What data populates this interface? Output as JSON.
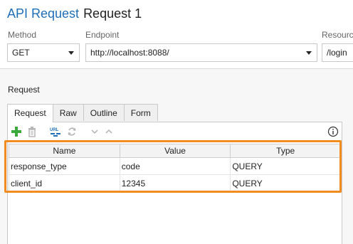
{
  "header": {
    "app": "API Request",
    "name": "Request 1"
  },
  "fields": {
    "method_label": "Method",
    "method_value": "GET",
    "endpoint_label": "Endpoint",
    "endpoint_value": "http://localhost:8088/",
    "resource_label": "Resource",
    "resource_value": "/login"
  },
  "section": {
    "label": "Request"
  },
  "tabs": [
    "Request",
    "Raw",
    "Outline",
    "Form"
  ],
  "toolbar": {
    "add_icon": "plus-icon",
    "delete_icon": "trash-icon",
    "url_icon": "url-encode-icon",
    "refresh_icon": "refresh-icon",
    "down_icon": "chevron-down-icon",
    "up_icon": "chevron-up-icon",
    "info_icon": "info-icon",
    "url_text": "URL"
  },
  "table": {
    "columns": [
      "Name",
      "Value",
      "Type"
    ],
    "rows": [
      {
        "name": "response_type",
        "value": "code",
        "type": "QUERY"
      },
      {
        "name": "client_id",
        "value": "12345",
        "type": "QUERY"
      }
    ]
  },
  "colors": {
    "accent": "#1f6fb8",
    "highlight": "#f28c1e",
    "add": "#3aa83a"
  }
}
